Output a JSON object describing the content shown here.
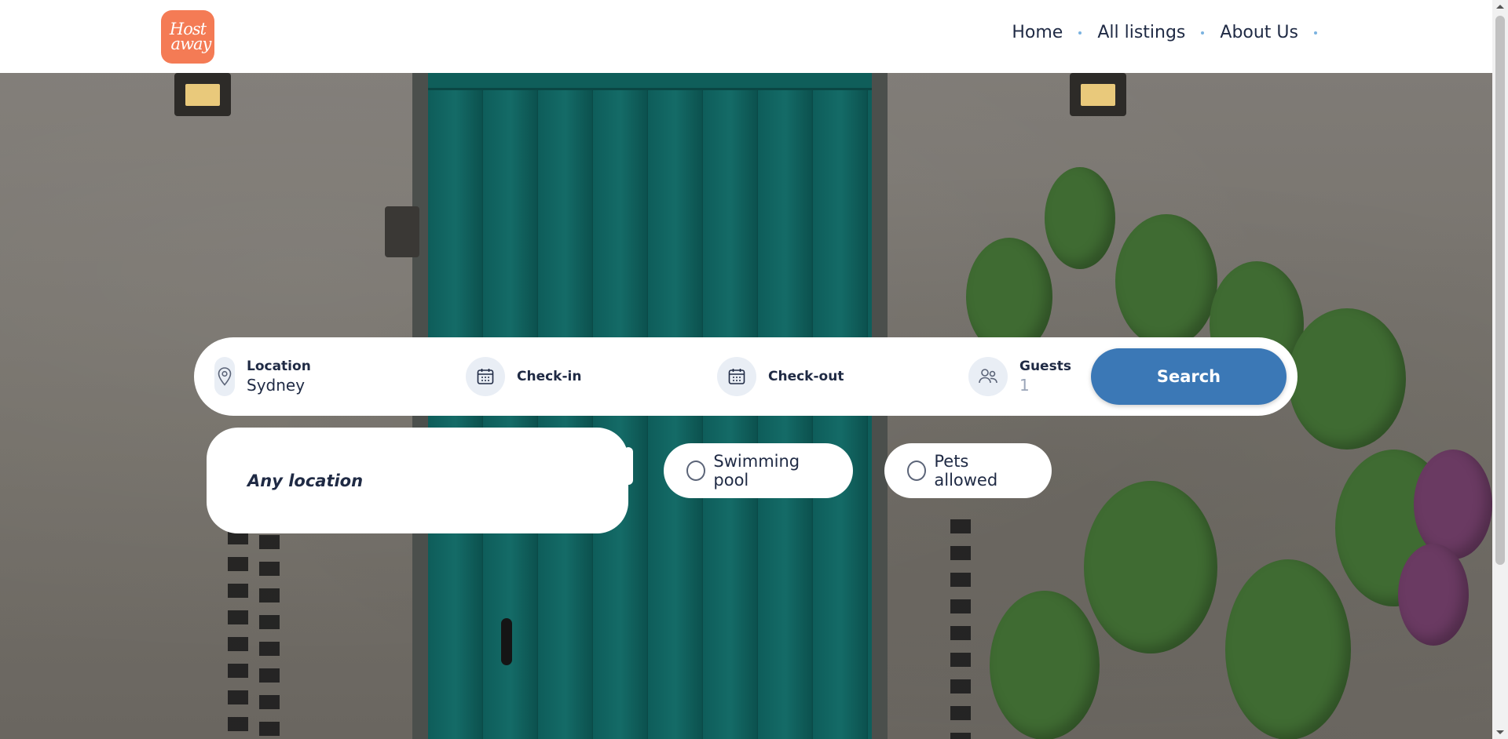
{
  "header": {
    "logo_line1": "Host",
    "logo_line2": "away",
    "nav": [
      {
        "label": "Home"
      },
      {
        "label": "All listings"
      },
      {
        "label": "About Us"
      }
    ]
  },
  "search": {
    "location_label": "Location",
    "location_value": "Sydney",
    "checkin_label": "Check-in",
    "checkout_label": "Check-out",
    "guests_label": "Guests",
    "guests_value": "1",
    "button_label": "Search"
  },
  "location_dropdown": {
    "option": "Any location"
  },
  "filters": [
    {
      "label": "Swimming pool",
      "checked": false
    },
    {
      "label": "Pets allowed",
      "checked": false
    }
  ],
  "colors": {
    "brand": "#f47b55",
    "primary_button": "#3b78b6",
    "text": "#1f2a44",
    "nav_dot": "#7bb3e0"
  },
  "icons": [
    "location-pin-icon",
    "calendar-icon",
    "users-icon"
  ]
}
